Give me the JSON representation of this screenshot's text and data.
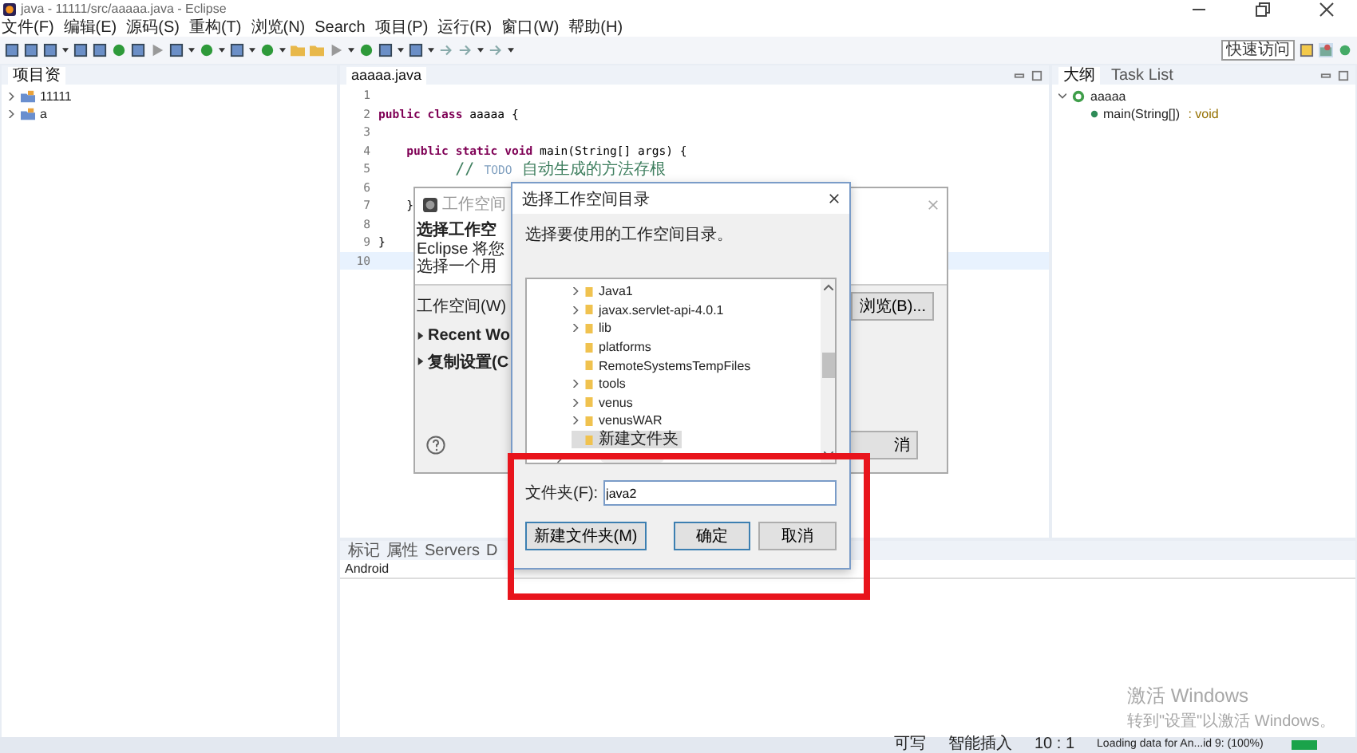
{
  "window": {
    "title": "java - 11111/src/aaaaa.java - Eclipse"
  },
  "menu": [
    "文件(F)",
    "编辑(E)",
    "源码(S)",
    "重构(T)",
    "浏览(N)",
    "Search",
    "项目(P)",
    "运行(R)",
    "窗口(W)",
    "帮助(H)"
  ],
  "quick_access": {
    "placeholder": "快速访问"
  },
  "project_explorer": {
    "tab": "项目资",
    "items": [
      {
        "label": "11111",
        "expanded": false
      },
      {
        "label": "a",
        "expanded": false
      }
    ]
  },
  "editor": {
    "tab": "aaaaa.java",
    "lines": [
      {
        "number": "1",
        "current": false
      },
      {
        "number": "2",
        "current": false,
        "segments": [
          {
            "kind": "keyword",
            "text": "public class"
          },
          {
            "kind": "plain",
            "text": " aaaaa {"
          }
        ]
      },
      {
        "number": "3",
        "current": false
      },
      {
        "number": "4",
        "current": false,
        "segments": [
          {
            "kind": "keyword",
            "text": "    public static void"
          },
          {
            "kind": "plain",
            "text": " main(String[] args) {"
          }
        ]
      },
      {
        "number": "5",
        "current": false,
        "segments": [
          {
            "kind": "comment",
            "text": "        // "
          },
          {
            "kind": "todo",
            "text": "TODO"
          },
          {
            "kind": "comment",
            "text": " 自动生成的方法存根"
          }
        ]
      },
      {
        "number": "6",
        "current": false
      },
      {
        "number": "7",
        "current": false,
        "segments": [
          {
            "kind": "plain",
            "text": "    }"
          }
        ]
      },
      {
        "number": "8",
        "current": false
      },
      {
        "number": "9",
        "current": false,
        "segments": [
          {
            "kind": "plain",
            "text": "}"
          }
        ]
      },
      {
        "number": "10",
        "current": true
      }
    ]
  },
  "outline": {
    "tabs": [
      {
        "label": "大纲",
        "selected": true
      },
      {
        "label": "Task List",
        "selected": false
      }
    ],
    "tree": [
      {
        "label": "aaaaa",
        "expanded": true,
        "children": [
          {
            "label": "main(String[])",
            "type": " : void"
          }
        ]
      }
    ]
  },
  "bottom_panel": {
    "tabs": [
      {
        "label": "标记",
        "selected": false
      },
      {
        "label": "属性",
        "selected": false
      },
      {
        "label": "Servers",
        "selected": false
      },
      {
        "label": "D",
        "selected": false
      }
    ],
    "content": "Android"
  },
  "background_dialog": {
    "title": "工作空间",
    "heading": "选择工作空",
    "description": [
      "Eclipse 将您",
      "选择一个用"
    ],
    "workspace_label": "工作空间(W)",
    "browse_button": "浏览(B)...",
    "sections": [
      "Recent Wo",
      "复制设置(C"
    ],
    "cancel_button": "消"
  },
  "dialog": {
    "title": "选择工作空间目录",
    "message": "选择要使用的工作空间目录。",
    "folders": [
      {
        "label": "Java1",
        "has_children": true,
        "selected": false
      },
      {
        "label": "javax.servlet-api-4.0.1",
        "has_children": true,
        "selected": false
      },
      {
        "label": "lib",
        "has_children": true,
        "selected": false
      },
      {
        "label": "platforms",
        "has_children": false,
        "selected": false
      },
      {
        "label": "RemoteSystemsTempFiles",
        "has_children": false,
        "selected": false
      },
      {
        "label": "tools",
        "has_children": true,
        "selected": false
      },
      {
        "label": "venus",
        "has_children": true,
        "selected": false
      },
      {
        "label": "venusWAR",
        "has_children": true,
        "selected": false
      },
      {
        "label": "新建文件夹",
        "has_children": false,
        "selected": true
      }
    ],
    "folder_label": "文件夹(F):",
    "folder_value": "java2",
    "buttons": [
      {
        "label": "新建文件夹(M)",
        "kind": "secondary"
      },
      {
        "label": "确定",
        "kind": "default"
      },
      {
        "label": "取消",
        "kind": "secondary"
      }
    ]
  },
  "status_bar": {
    "items": [
      "可写",
      "智能插入",
      "10 : 1",
      "Loading data for An...id 9: (100%)"
    ],
    "progress": {
      "level": 1
    }
  },
  "os_overlay": {
    "title": "激活 Windows",
    "subtitle": "转到\"设置\"以激活 Windows。"
  }
}
